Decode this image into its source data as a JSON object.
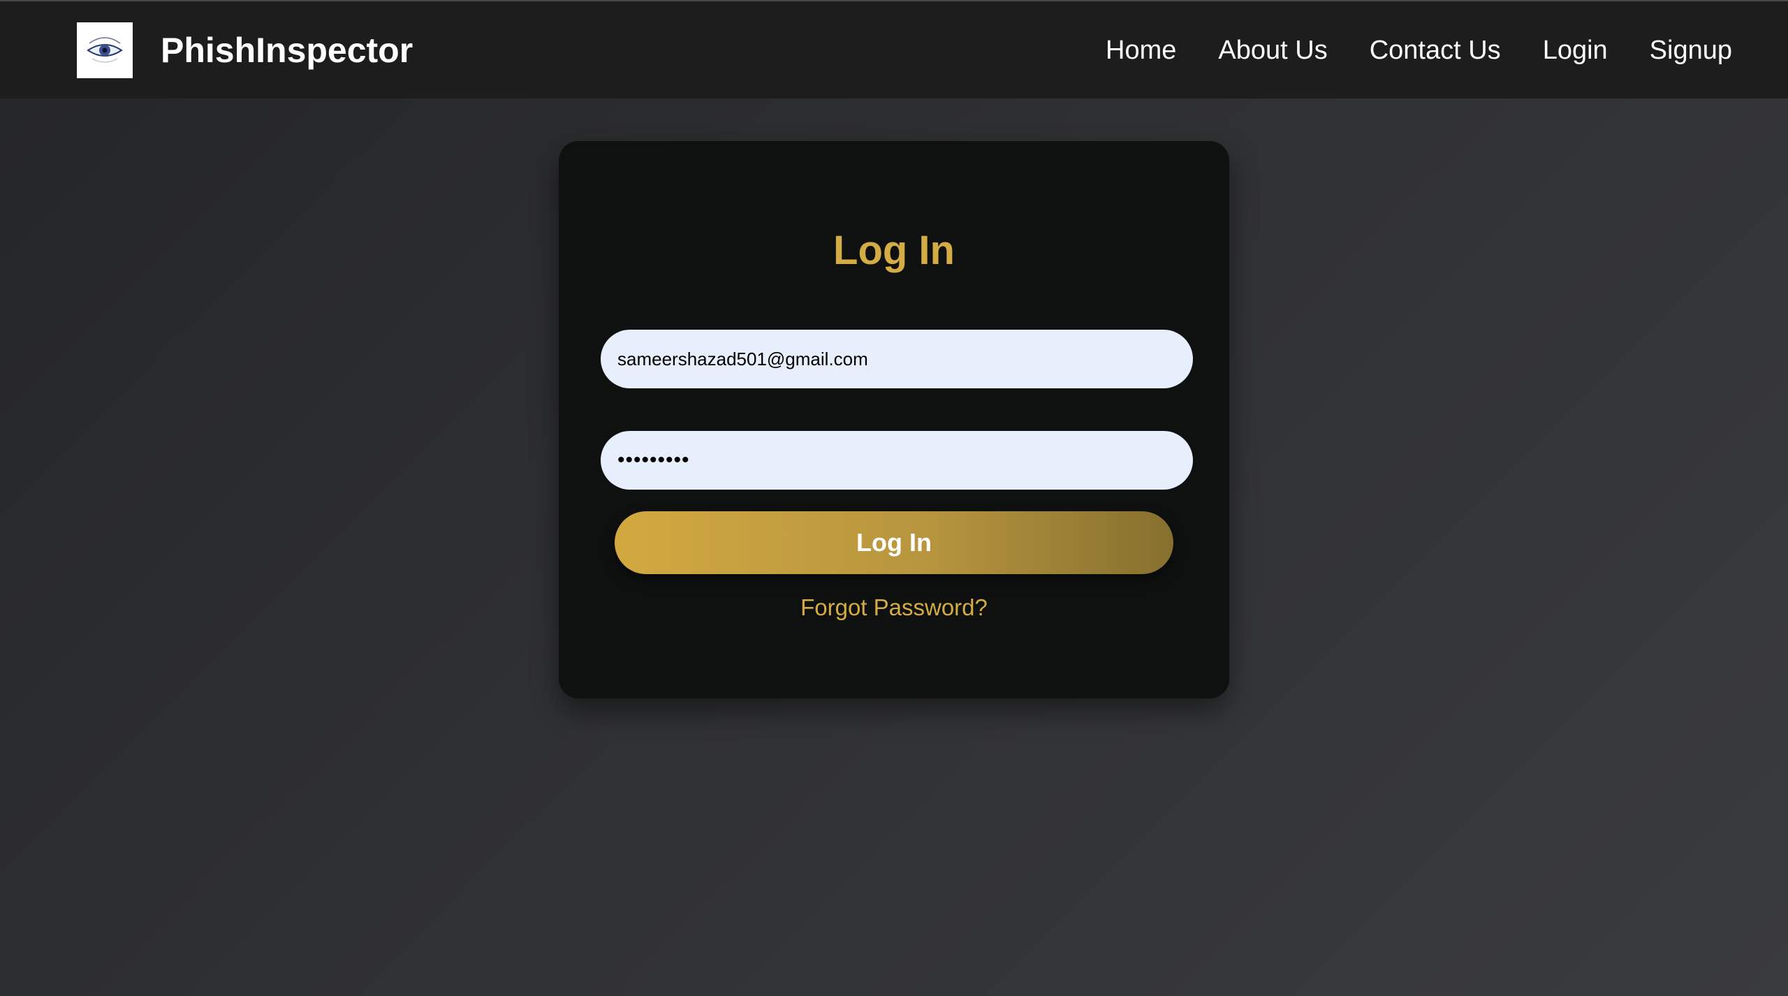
{
  "header": {
    "brand": "PhishInspector",
    "logo_icon": "eye-logo-icon",
    "nav": [
      {
        "label": "Home"
      },
      {
        "label": "About Us"
      },
      {
        "label": "Contact Us"
      },
      {
        "label": "Login"
      },
      {
        "label": "Signup"
      }
    ]
  },
  "login_form": {
    "title": "Log In",
    "email_value": "sameershazad501@gmail.com",
    "password_value": "•••••••••",
    "submit_label": "Log In",
    "forgot_label": "Forgot Password?"
  },
  "colors": {
    "accent": "#d4ac45",
    "navbar_bg": "#1d1d1e",
    "card_bg": "#0f1010",
    "input_bg": "#e8effc"
  }
}
